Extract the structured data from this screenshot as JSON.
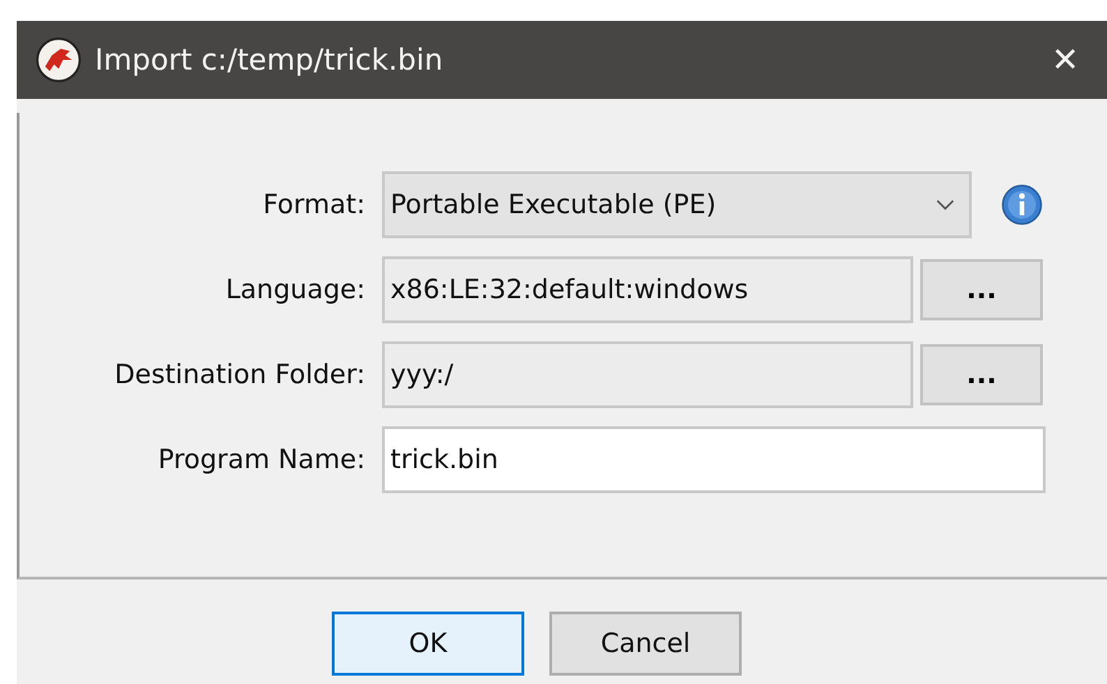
{
  "window": {
    "title": "Import c:/temp/trick.bin",
    "close": "✕"
  },
  "fields": [
    {
      "kind": "dropdown",
      "label": "Format:",
      "value": "Portable Executable (PE)"
    },
    {
      "kind": "browse",
      "label": "Language:",
      "value": "x86:LE:32:default:windows",
      "editable": false,
      "button": "..."
    },
    {
      "kind": "browse",
      "label": "Destination Folder:",
      "value": "yyy:/",
      "editable": false,
      "button": "..."
    },
    {
      "kind": "text",
      "label": "Program Name:",
      "value": "trick.bin",
      "editable": true
    }
  ],
  "buttons": [
    {
      "label": "OK",
      "default": true
    },
    {
      "label": "Cancel",
      "default": false
    }
  ]
}
